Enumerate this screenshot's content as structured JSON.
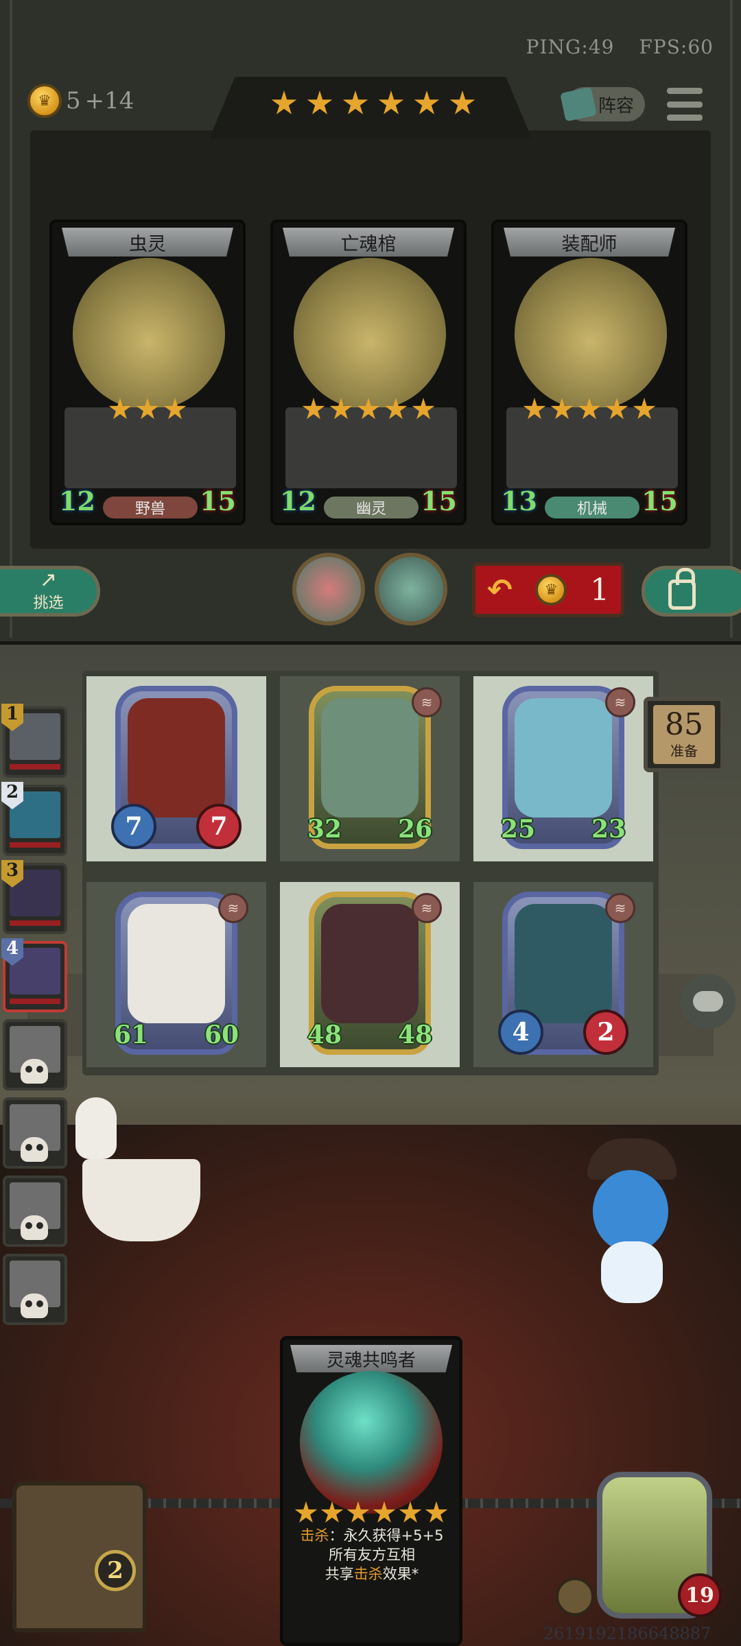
{
  "status": {
    "ping": "PING:49",
    "fps": "FPS:60"
  },
  "gold": {
    "current": "5",
    "income": "+14"
  },
  "shop_tier_stars": 6,
  "lineup_button": "阵容",
  "shop_cards": [
    {
      "name": "虫灵",
      "stars": 3,
      "attack": "12",
      "health": "15",
      "tribe": "野兽",
      "tribe_color": "#7e463c"
    },
    {
      "name": "亡魂棺",
      "stars": 5,
      "attack": "12",
      "health": "15",
      "tribe": "幽灵",
      "tribe_color": "#6d7660"
    },
    {
      "name": "装配师",
      "stars": 5,
      "attack": "13",
      "health": "15",
      "tribe": "机械",
      "tribe_color": "#4a8a72"
    }
  ],
  "pick_button": "挑选",
  "refresh": {
    "cost": "1"
  },
  "prep_timer": {
    "value": "85",
    "label": "准备"
  },
  "queue": [
    {
      "rank": "1",
      "dead": false,
      "color": "#c59a2e",
      "face": "#5b5f66"
    },
    {
      "rank": "2",
      "dead": false,
      "color": "#dfe5ea",
      "face": "#2f6f86"
    },
    {
      "rank": "3",
      "dead": false,
      "color": "#c59a2e",
      "face": "#3a3350"
    },
    {
      "rank": "4",
      "dead": false,
      "color": "#5a70a6",
      "face": "#47406a",
      "highlight": true
    },
    {
      "rank": "",
      "dead": true
    },
    {
      "rank": "",
      "dead": true
    },
    {
      "rank": "",
      "dead": true
    },
    {
      "rank": "",
      "dead": true
    }
  ],
  "board_minions": [
    {
      "attack": "7",
      "health": "7",
      "frame": "blue",
      "attack_style": "circle",
      "health_style": "circle",
      "portrait": "#7e2b24",
      "claw": false
    },
    {
      "attack": "32",
      "health": "26",
      "frame": "gold",
      "attack_style": "green",
      "health_style": "green",
      "portrait": "#6e8f7a",
      "claw": true
    },
    {
      "attack": "25",
      "health": "23",
      "frame": "blue",
      "attack_style": "green",
      "health_style": "green",
      "portrait": "#79b8c8",
      "claw": true
    },
    {
      "attack": "61",
      "health": "60",
      "frame": "blue",
      "attack_style": "green",
      "health_style": "green",
      "portrait": "#e8e6de",
      "claw": true
    },
    {
      "attack": "48",
      "health": "48",
      "frame": "gold",
      "attack_style": "green",
      "health_style": "green",
      "portrait": "#4a2d30",
      "claw": true
    },
    {
      "attack": "4",
      "health": "2",
      "frame": "blue",
      "attack_style": "circle",
      "health_style": "circle",
      "portrait": "#2f5a64",
      "claw": true
    }
  ],
  "hand_card": {
    "name": "灵魂共鸣者",
    "stars": 6,
    "line1_keyword": "击杀",
    "line1_rest": "：永久获得+5+5",
    "line2": "所有友方互相",
    "line3_a": "共享",
    "line3_keyword": "击杀",
    "line3_b": "效果*"
  },
  "hero_health": "19",
  "tavern_level": "2",
  "watermark": "2619192186648887"
}
